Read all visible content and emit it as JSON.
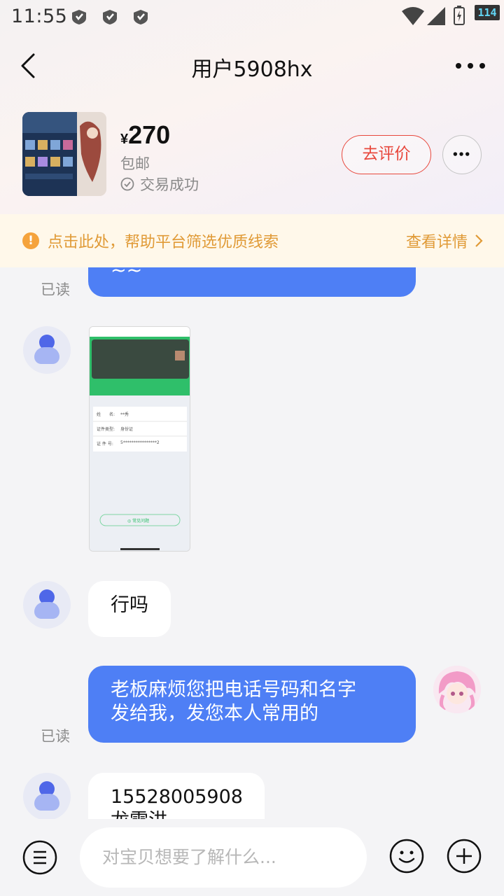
{
  "status_bar": {
    "time": "11:55",
    "battery": "114"
  },
  "nav": {
    "title": "用户5908hx"
  },
  "product": {
    "currency": "¥",
    "price": "270",
    "shipping": "包邮",
    "status": "交易成功",
    "review_button": "去评价"
  },
  "tip": {
    "text": "点击此处，帮助平台筛选优质线索",
    "link": "查看详情",
    "icon": "!"
  },
  "messages": {
    "m1_text": "~~",
    "m1_read": "已读",
    "m3_text": "行吗",
    "m4_line1": "老板麻烦您把电话号码和名字",
    "m4_line2": "发给我，发您本人常用的",
    "m4_read": "已读",
    "m5_line1": "15528005908",
    "m5_line2": "龙雪洪"
  },
  "screenshot_image": {
    "name_label": "姓　　名:",
    "name_value": "**秀",
    "id_type_label": "证件类型:",
    "id_type_value": "身份证",
    "id_no_label": "证 件 号:",
    "id_no_value": "5****************2",
    "button": "◎ 常见问题"
  },
  "composer": {
    "placeholder": "对宝贝想要了解什么..."
  },
  "colors": {
    "accent_blue": "#4e7ff5",
    "accent_red": "#e8483d",
    "tip_orange": "#e09a36"
  }
}
